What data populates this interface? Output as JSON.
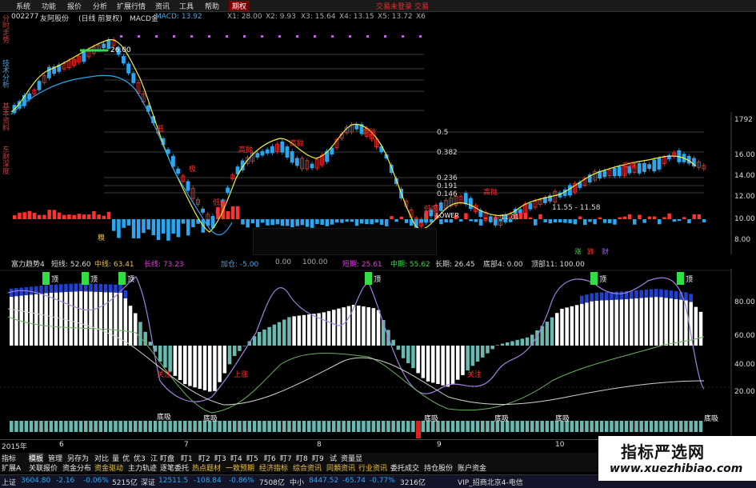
{
  "menu": {
    "items": [
      "系统",
      "功能",
      "报价",
      "分析",
      "扩展行情",
      "资讯",
      "工具",
      "帮助"
    ],
    "active": "期权",
    "right_items": [
      "交易未登录",
      "交易"
    ]
  },
  "side_tabs": [
    "分时走势",
    "技术分析",
    "基本资料",
    "东财深度"
  ],
  "main_chart": {
    "stock_code": "002277",
    "stock_name": "友阿股份",
    "period": "(日线 前复权)",
    "indicator": "MACD金",
    "macd_label": "MACD: 13.92",
    "params": [
      "X1: 28.00",
      "X2: 9.93",
      "X3: 15.64",
      "X4: 13.15",
      "X5: 13.72",
      "X6"
    ],
    "top_marker": "26.00",
    "fib_levels": [
      "0.5",
      "0.382",
      "0.236",
      "0.191",
      "0.146"
    ],
    "y_ticks": [
      "1792",
      "16.00",
      "14.00",
      "12.00",
      "10.00",
      "8.00"
    ],
    "labels": {
      "low": "低",
      "ji": "极",
      "high_1": "高抛",
      "high_2": "高抛",
      "high_3": "高抛",
      "high_4": "高抛",
      "high_5": "高抛",
      "low_buy_1": "低吸",
      "low_buy_2": "低吸",
      "range": "11.55 - 11.58",
      "price_tag": "11.01",
      "lower": "LOWER"
    },
    "bottom_marks": {
      "left": "糗",
      "right_green": "涨",
      "right_red": "跌",
      "right_purple": "财"
    }
  },
  "lower_chart": {
    "info": {
      "name": "富力趋势4",
      "short": "短线: 52.60",
      "mid": "中线: 63.41",
      "long": "长线: 73.23",
      "add": "加仓: -5.00",
      "zero": "0.00",
      "hundred": "100.00",
      "short_term": "短期: 25.61",
      "mid_term": "中期: 55.62",
      "long_term": "长期: 26.45",
      "bottom": "底部4: 0.00",
      "top": "顶部11: 100.00"
    },
    "y_ticks": [
      "80.00",
      "60.00",
      "40.00",
      "20.00"
    ],
    "ding": "顶",
    "bottom_label": "底吸",
    "guanzhu": "关注",
    "lianxu": "上涨"
  },
  "x_axis": {
    "year": "2015年",
    "months": [
      "6",
      "7",
      "8",
      "9",
      "10"
    ]
  },
  "tabs_row1": {
    "items": [
      "指标",
      "模板",
      "管理",
      "另存为",
      "对比",
      "量",
      "优",
      "优3",
      "江",
      "盯盘",
      "盯1",
      "盯2",
      "盯3",
      "盯4",
      "盯5",
      "盯6",
      "盯7",
      "盯8",
      "盯9",
      "试",
      "资量显"
    ],
    "selected": "模板"
  },
  "tabs_row2": {
    "items": [
      "扩展A",
      "关联报价",
      "资金分布",
      "资金驱动",
      "主力轨迹",
      "逐笔委托",
      "热点题材",
      "一致预期",
      "经济指标",
      "综合资讯",
      "同類资讯",
      "行业资讯",
      "委托成交",
      "持仓股份",
      "账户资金"
    ],
    "highlighted": [
      "资金驱动",
      "热点题材",
      "一致预期",
      "经济指标",
      "综合资讯",
      "同類资讯",
      "行业资讯"
    ]
  },
  "status": {
    "sh_name": "上证",
    "sh_val": "3604.80",
    "sh_chg": "-2.16",
    "sh_pct": "-0.06%",
    "sh_vol": "5215亿",
    "sz_name": "深证",
    "sz_val": "12511.5",
    "sz_chg": "-108.84",
    "sz_pct": "-0.86%",
    "sz_vol": "7508亿",
    "zx_name": "中小",
    "zx_val": "8447.52",
    "zx_chg": "-65.74",
    "zx_pct": "-0.77%",
    "zx_vol": "3216亿",
    "server": "VIP_招商北京4-电信"
  },
  "watermark": {
    "title": "指标严选网",
    "url": "www.xuezhibiao.com"
  },
  "colors": {
    "up": "#ff3030",
    "down": "#2aa7f0",
    "yellow": "#f0f040",
    "magenta": "#e040e0",
    "teal": "#6ab8b0",
    "green": "#33dd44"
  }
}
